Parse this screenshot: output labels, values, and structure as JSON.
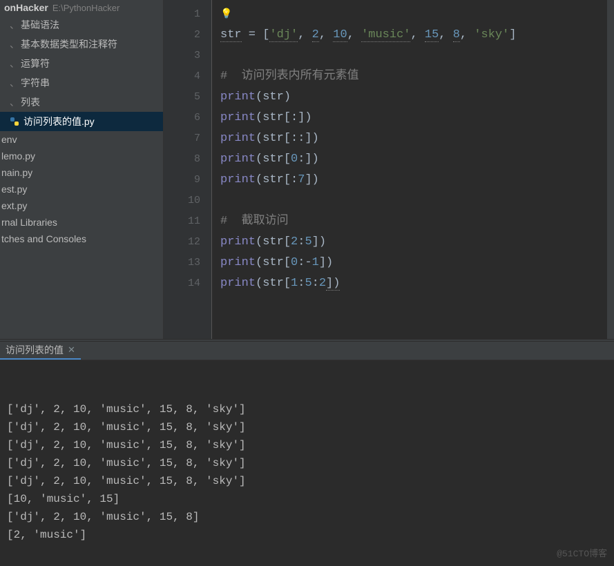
{
  "project": {
    "name": "onHacker",
    "path": "E:\\PythonHacker"
  },
  "sidebar": {
    "items": [
      {
        "bullet": "、",
        "label": "基础语法"
      },
      {
        "bullet": "、",
        "label": "基本数据类型和注释符"
      },
      {
        "bullet": "、",
        "label": "运算符"
      },
      {
        "bullet": "、",
        "label": "字符串"
      },
      {
        "bullet": "、",
        "label": "列表"
      },
      {
        "icon": "py",
        "label": "访问列表的值.py",
        "selected": true
      },
      {
        "label": "env"
      },
      {
        "label": "lemo.py"
      },
      {
        "label": "nain.py"
      },
      {
        "label": "est.py"
      },
      {
        "label": "ext.py"
      },
      {
        "label": "rnal Libraries"
      },
      {
        "label": "tches and Consoles"
      }
    ]
  },
  "editor": {
    "line_numbers": [
      "1",
      "2",
      "3",
      "4",
      "5",
      "6",
      "7",
      "8",
      "9",
      "10",
      "11",
      "12",
      "13",
      "14"
    ],
    "code_tokens": [
      [
        {
          "t": "bulb",
          "v": "💡"
        }
      ],
      [
        {
          "t": "var",
          "v": "str",
          "squig": true
        },
        {
          "t": "op",
          "v": " = ["
        },
        {
          "t": "str",
          "v": "'dj'",
          "squig": true
        },
        {
          "t": "op",
          "v": ", "
        },
        {
          "t": "num",
          "v": "2",
          "squig": true
        },
        {
          "t": "op",
          "v": ", "
        },
        {
          "t": "num",
          "v": "10",
          "squig": true
        },
        {
          "t": "op",
          "v": ", "
        },
        {
          "t": "str",
          "v": "'music'",
          "squig": true
        },
        {
          "t": "op",
          "v": ", "
        },
        {
          "t": "num",
          "v": "15",
          "squig": true
        },
        {
          "t": "op",
          "v": ", "
        },
        {
          "t": "num",
          "v": "8",
          "squig": true
        },
        {
          "t": "op",
          "v": ", "
        },
        {
          "t": "str",
          "v": "'sky'"
        },
        {
          "t": "op",
          "v": "]"
        }
      ],
      [],
      [
        {
          "t": "com",
          "v": "#  访问列表内所有元素值"
        }
      ],
      [
        {
          "t": "bi",
          "v": "print"
        },
        {
          "t": "op",
          "v": "("
        },
        {
          "t": "var",
          "v": "str"
        },
        {
          "t": "op",
          "v": ")"
        }
      ],
      [
        {
          "t": "bi",
          "v": "print"
        },
        {
          "t": "op",
          "v": "("
        },
        {
          "t": "var",
          "v": "str"
        },
        {
          "t": "op",
          "v": "[:])"
        }
      ],
      [
        {
          "t": "bi",
          "v": "print"
        },
        {
          "t": "op",
          "v": "("
        },
        {
          "t": "var",
          "v": "str"
        },
        {
          "t": "op",
          "v": "[::])"
        }
      ],
      [
        {
          "t": "bi",
          "v": "print"
        },
        {
          "t": "op",
          "v": "("
        },
        {
          "t": "var",
          "v": "str"
        },
        {
          "t": "op",
          "v": "["
        },
        {
          "t": "num",
          "v": "0"
        },
        {
          "t": "op",
          "v": ":])"
        }
      ],
      [
        {
          "t": "bi",
          "v": "print"
        },
        {
          "t": "op",
          "v": "("
        },
        {
          "t": "var",
          "v": "str"
        },
        {
          "t": "op",
          "v": "[:"
        },
        {
          "t": "num",
          "v": "7"
        },
        {
          "t": "op",
          "v": "])"
        }
      ],
      [],
      [
        {
          "t": "com",
          "v": "#  截取访问"
        }
      ],
      [
        {
          "t": "bi",
          "v": "print"
        },
        {
          "t": "op",
          "v": "("
        },
        {
          "t": "var",
          "v": "str"
        },
        {
          "t": "op",
          "v": "["
        },
        {
          "t": "num",
          "v": "2"
        },
        {
          "t": "op",
          "v": ":"
        },
        {
          "t": "num",
          "v": "5"
        },
        {
          "t": "op",
          "v": "])"
        }
      ],
      [
        {
          "t": "bi",
          "v": "print"
        },
        {
          "t": "op",
          "v": "("
        },
        {
          "t": "var",
          "v": "str"
        },
        {
          "t": "op",
          "v": "["
        },
        {
          "t": "num",
          "v": "0"
        },
        {
          "t": "op",
          "v": ":-"
        },
        {
          "t": "num",
          "v": "1"
        },
        {
          "t": "op",
          "v": "])"
        }
      ],
      [
        {
          "t": "bi",
          "v": "print"
        },
        {
          "t": "op",
          "v": "("
        },
        {
          "t": "var",
          "v": "str"
        },
        {
          "t": "op",
          "v": "["
        },
        {
          "t": "num",
          "v": "1"
        },
        {
          "t": "op",
          "v": ":"
        },
        {
          "t": "num",
          "v": "5"
        },
        {
          "t": "op",
          "v": ":"
        },
        {
          "t": "num",
          "v": "2"
        },
        {
          "t": "op",
          "v": "])",
          "squig": true
        }
      ]
    ]
  },
  "console": {
    "tab_title": "访问列表的值",
    "output_lines": [
      "['dj', 2, 10, 'music', 15, 8, 'sky']",
      "['dj', 2, 10, 'music', 15, 8, 'sky']",
      "['dj', 2, 10, 'music', 15, 8, 'sky']",
      "['dj', 2, 10, 'music', 15, 8, 'sky']",
      "['dj', 2, 10, 'music', 15, 8, 'sky']",
      "[10, 'music', 15]",
      "['dj', 2, 10, 'music', 15, 8]",
      "[2, 'music']"
    ]
  },
  "watermark": "@51CTO博客"
}
